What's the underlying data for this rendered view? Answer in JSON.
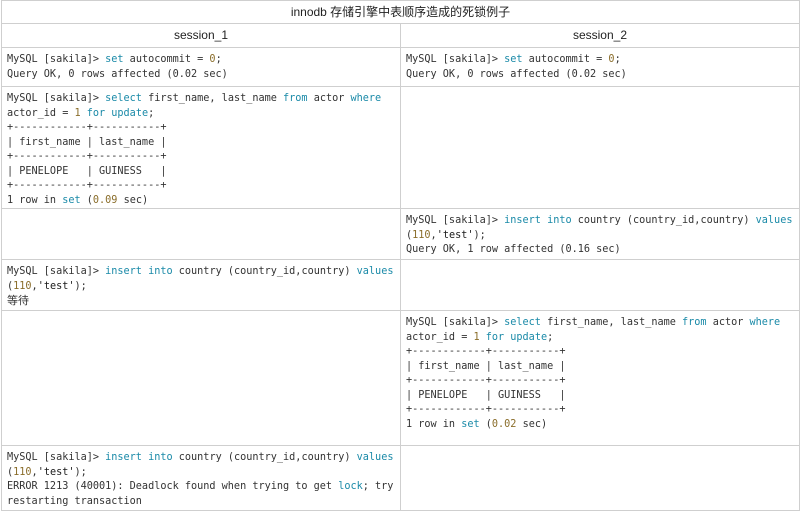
{
  "title": "innodb 存储引擎中表顺序造成的死锁例子",
  "headers": {
    "session_1": "session_1",
    "session_2": "session_2"
  },
  "rows": [
    {
      "s1": {
        "l1": {
          "prompt": "MySQL [sakila]> ",
          "kw1": "set",
          "rest1": " autocommit = ",
          "num1": "0",
          "rest2": ";"
        },
        "l2": "Query OK, 0 rows affected (0.02 sec)"
      },
      "s2": {
        "l1": {
          "prompt": "MySQL [sakila]> ",
          "kw1": "set",
          "rest1": " autocommit = ",
          "num1": "0",
          "rest2": ";"
        },
        "l2": "Query OK, 0 rows affected (0.02 sec)"
      }
    },
    {
      "s1": {
        "l1": {
          "prompt": "MySQL [sakila]> ",
          "kw1": "select",
          "rest1": " first_name, last_name ",
          "kw2": "from",
          "rest2": " actor ",
          "kw3": "where"
        },
        "l2": {
          "rest1": "actor_id = ",
          "num1": "1",
          "rest2": " ",
          "kw1": "for update",
          "rest3": ";"
        },
        "table": [
          "+------------+-----------+",
          "| first_name | last_name |",
          "+------------+-----------+",
          "| PENELOPE   | GUINESS   |",
          "+------------+-----------+"
        ],
        "result": {
          "pre": "1 row in ",
          "kw": "set",
          "mid": " (",
          "num": "0.09",
          "post": " sec)"
        }
      }
    },
    {
      "s2": {
        "l1": {
          "prompt": "MySQL [sakila]> ",
          "kw1": "insert",
          "sp1": " ",
          "kw2": "into",
          "rest1": " country (country_id,country) ",
          "kw3": "values"
        },
        "l2": {
          "p1": "(",
          "num1": "110",
          "rest1": ",",
          "str1": "'test'",
          "rest2": ");"
        },
        "l3": "Query OK, 1 row affected (0.16 sec)"
      }
    },
    {
      "s1": {
        "l1": {
          "prompt": "MySQL [sakila]> ",
          "kw1": "insert",
          "sp1": " ",
          "kw2": "into",
          "rest1": " country (country_id,country) ",
          "kw3": "values"
        },
        "l2": {
          "p1": "(",
          "num1": "110",
          "rest1": ",",
          "str1": "'test'",
          "rest2": ");"
        },
        "l3": "等待"
      }
    },
    {
      "s2": {
        "l1": {
          "prompt": "MySQL [sakila]> ",
          "kw1": "select",
          "rest1": " first_name, last_name ",
          "kw2": "from",
          "rest2": " actor ",
          "kw3": "where"
        },
        "l2": {
          "rest1": "actor_id = ",
          "num1": "1",
          "rest2": " ",
          "kw1": "for update",
          "rest3": ";"
        },
        "table": [
          "+------------+-----------+",
          "| first_name | last_name |",
          "+------------+-----------+",
          "| PENELOPE   | GUINESS   |",
          "+------------+-----------+"
        ],
        "result": {
          "pre": "1 row in ",
          "kw": "set",
          "mid": " (",
          "num": "0.02",
          "post": " sec)"
        }
      }
    },
    {
      "s1": {
        "l1": {
          "prompt": "MySQL [sakila]> ",
          "kw1": "insert",
          "sp1": " ",
          "kw2": "into",
          "rest1": " country (country_id,country) ",
          "kw3": "values"
        },
        "l2": {
          "p1": "(",
          "num1": "110",
          "rest1": ",",
          "str1": "'test'",
          "rest2": ");"
        },
        "l3": {
          "pre": "ERROR 1213 (40001): Deadlock found when trying to get ",
          "kw": "lock",
          "post": "; try"
        },
        "l4": "restarting transaction"
      }
    }
  ]
}
